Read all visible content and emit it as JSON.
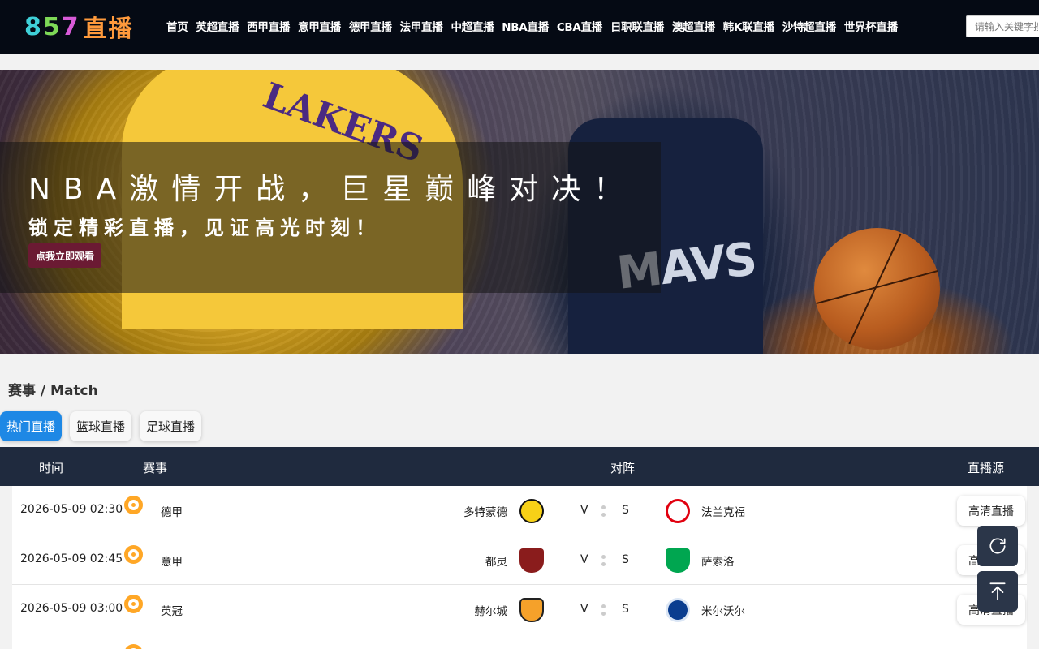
{
  "header": {
    "logo_digits": [
      "8",
      "5",
      "7"
    ],
    "logo_text": "直播",
    "nav": [
      "首页",
      "英超直播",
      "西甲直播",
      "意甲直播",
      "德甲直播",
      "法甲直播",
      "中超直播",
      "NBA直播",
      "CBA直播",
      "日职联直播",
      "澳超直播",
      "韩K联直播",
      "沙特超直播",
      "世界杯直播"
    ],
    "search_placeholder": "请输入关键字搜索"
  },
  "banner": {
    "headline": "NBA激情开战，巨星巅峰对决！",
    "subline": "锁定精彩直播，见证高光时刻！",
    "cta": "点我立即观看",
    "jersey_left": "LAKERS",
    "jersey_right": "MAVS"
  },
  "section": {
    "title": "赛事 / Match",
    "tabs": [
      "热门直播",
      "篮球直播",
      "足球直播"
    ],
    "active_tab": "热门直播"
  },
  "table": {
    "headers": {
      "time": "时间",
      "league": "赛事",
      "matchup": "对阵",
      "source": "直播源"
    },
    "rows": [
      {
        "time": "2026-05-09 02:30",
        "league": "德甲",
        "home": "多特蒙德",
        "v": "V",
        "s": "S",
        "away": "法兰克福",
        "live": "高清直播",
        "home_color": "#f7d117",
        "away_color": "#e1000f"
      },
      {
        "time": "2026-05-09 02:45",
        "league": "意甲",
        "home": "都灵",
        "v": "V",
        "s": "S",
        "away": "萨索洛",
        "live": "高清直播",
        "home_color": "#8a1c1c",
        "away_color": "#00a650"
      },
      {
        "time": "2026-05-09 03:00",
        "league": "英冠",
        "home": "赫尔城",
        "v": "V",
        "s": "S",
        "away": "米尔沃尔",
        "live": "高清直播",
        "home_color": "#f5a12a",
        "away_color": "#0a3d8f"
      }
    ]
  },
  "floating": [
    "refresh-icon",
    "back-to-top-icon"
  ]
}
